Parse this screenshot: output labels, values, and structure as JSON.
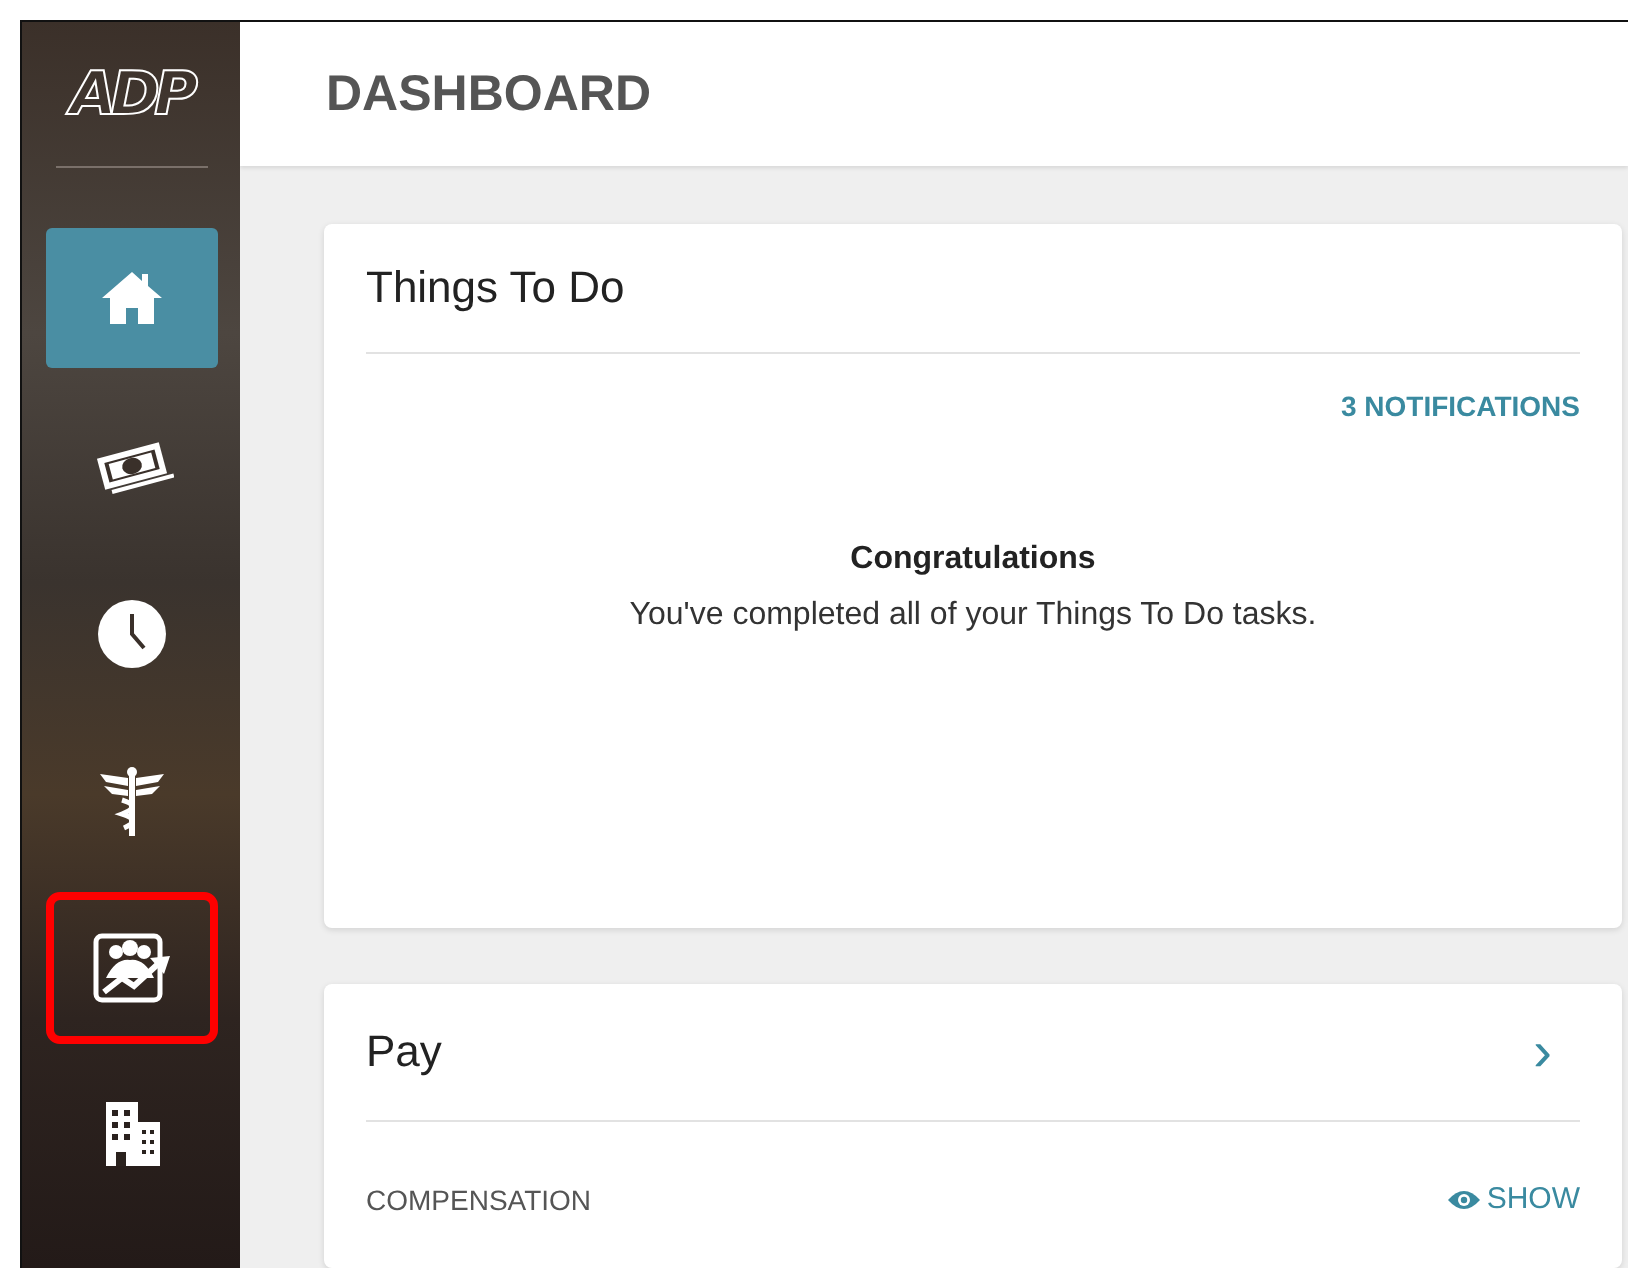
{
  "logo": "ADP",
  "sidebar": {
    "items": [
      {
        "kind": "home",
        "selected": true,
        "highlighted": false
      },
      {
        "kind": "money",
        "selected": false,
        "highlighted": false
      },
      {
        "kind": "clock",
        "selected": false,
        "highlighted": false
      },
      {
        "kind": "caduceus",
        "selected": false,
        "highlighted": false
      },
      {
        "kind": "people-chart",
        "selected": false,
        "highlighted": true
      },
      {
        "kind": "building",
        "selected": false,
        "highlighted": false
      }
    ]
  },
  "header": {
    "title": "DASHBOARD"
  },
  "things_to_do": {
    "title": "Things To Do",
    "notifications": "3 NOTIFICATIONS",
    "heading": "Congratulations",
    "message": "You've completed all of your Things To Do tasks."
  },
  "pay": {
    "title": "Pay",
    "chevron": "›",
    "label": "COMPENSATION",
    "action": "SHOW"
  }
}
